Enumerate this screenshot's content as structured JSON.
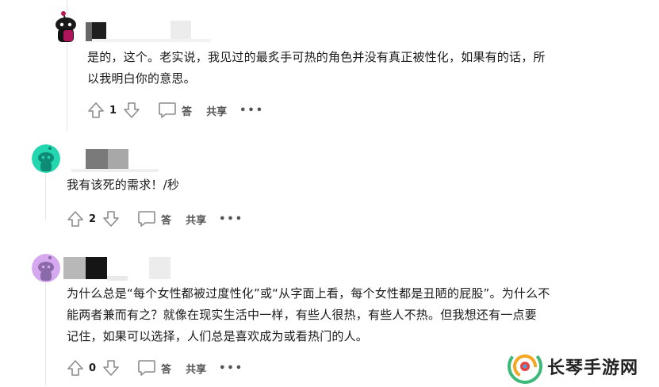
{
  "comments": [
    {
      "body_lines": [
        "是的，这个。老实说，我见过的最炙手可热的角色并没有真正被性化，如果有的话，所",
        "以我明白你的意思。"
      ],
      "score": "1",
      "reply_label": "答",
      "share_label": "共享",
      "more_label": "•••",
      "avatar_icon": "snoo-dark-avatar-icon"
    },
    {
      "body_lines": [
        "我有该死的需求！/秒"
      ],
      "score": "2",
      "reply_label": "答",
      "share_label": "共享",
      "more_label": "•••",
      "avatar_icon": "snoo-teal-avatar-icon"
    },
    {
      "body_lines": [
        "为什么总是“每个女性都被过度性化”或“从字面上看，每个女性都是丑陋的屁股”。为什么不",
        "能两者兼而有之？就像在现实生活中一样，有些人很热，有些人不热。但我想还有一点要",
        "记住，如果可以选择，人们总是喜欢成为或看热门的人。"
      ],
      "score": "0",
      "reply_label": "答",
      "share_label": "共享",
      "more_label": "•••",
      "avatar_icon": "snoo-purple-avatar-icon"
    }
  ],
  "watermark": {
    "text": "长琴手游网"
  },
  "colors": {
    "icon_gray": "#8c8c8c",
    "text": "#1a1a1b",
    "thread_line": "#e5e5e5"
  }
}
